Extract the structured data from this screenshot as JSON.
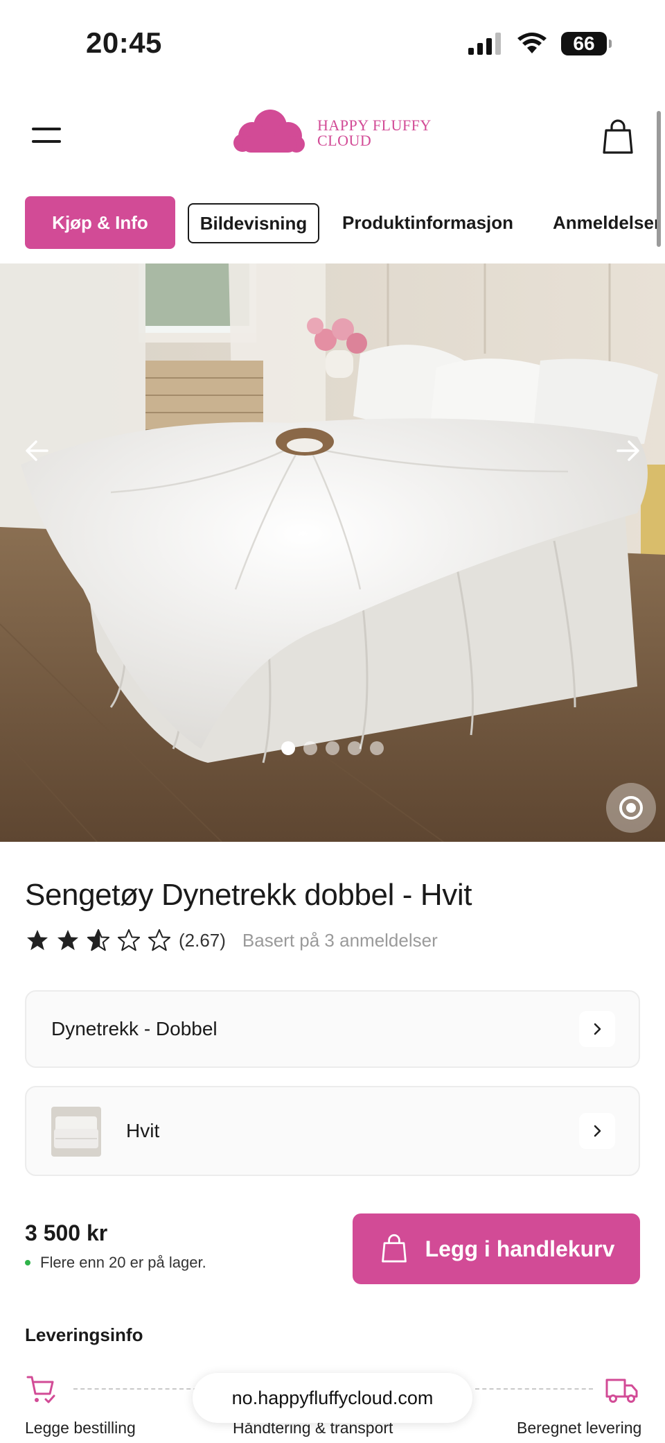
{
  "status_bar": {
    "time": "20:45",
    "battery": "66"
  },
  "header": {
    "brand_line1": "HAPPY FLUFFY",
    "brand_line2": "CLOUD",
    "menu_icon": "hamburger-icon",
    "cart_icon": "shopping-bag-icon"
  },
  "tabs": [
    {
      "label": "Kjøp & Info",
      "state": "active"
    },
    {
      "label": "Bildevisning",
      "state": "outlined"
    },
    {
      "label": "Produktinformasjon",
      "state": "plain"
    },
    {
      "label": "Anmeldelser",
      "state": "plain"
    }
  ],
  "gallery": {
    "image_count": 5,
    "active_index": 0
  },
  "product": {
    "title": "Sengetøy Dynetrekk dobbel - Hvit",
    "rating": 2.67,
    "rating_label": "(2.67)",
    "reviews_text": "Basert på 3 anmeldelser",
    "size_option": "Dynetrekk - Dobbel",
    "color_option": "Hvit",
    "price": "3 500 kr",
    "stock": "Flere enn 20 er på lager.",
    "add_to_cart": "Legg i handlekurv"
  },
  "delivery": {
    "title": "Leveringsinfo",
    "steps": [
      "Legge bestilling",
      "Håndtering & transport",
      "Beregnet levering"
    ]
  },
  "browser": {
    "url": "no.happyfluffycloud.com"
  },
  "colors": {
    "brand": "#d24b96",
    "stock_green": "#2fb34a"
  }
}
